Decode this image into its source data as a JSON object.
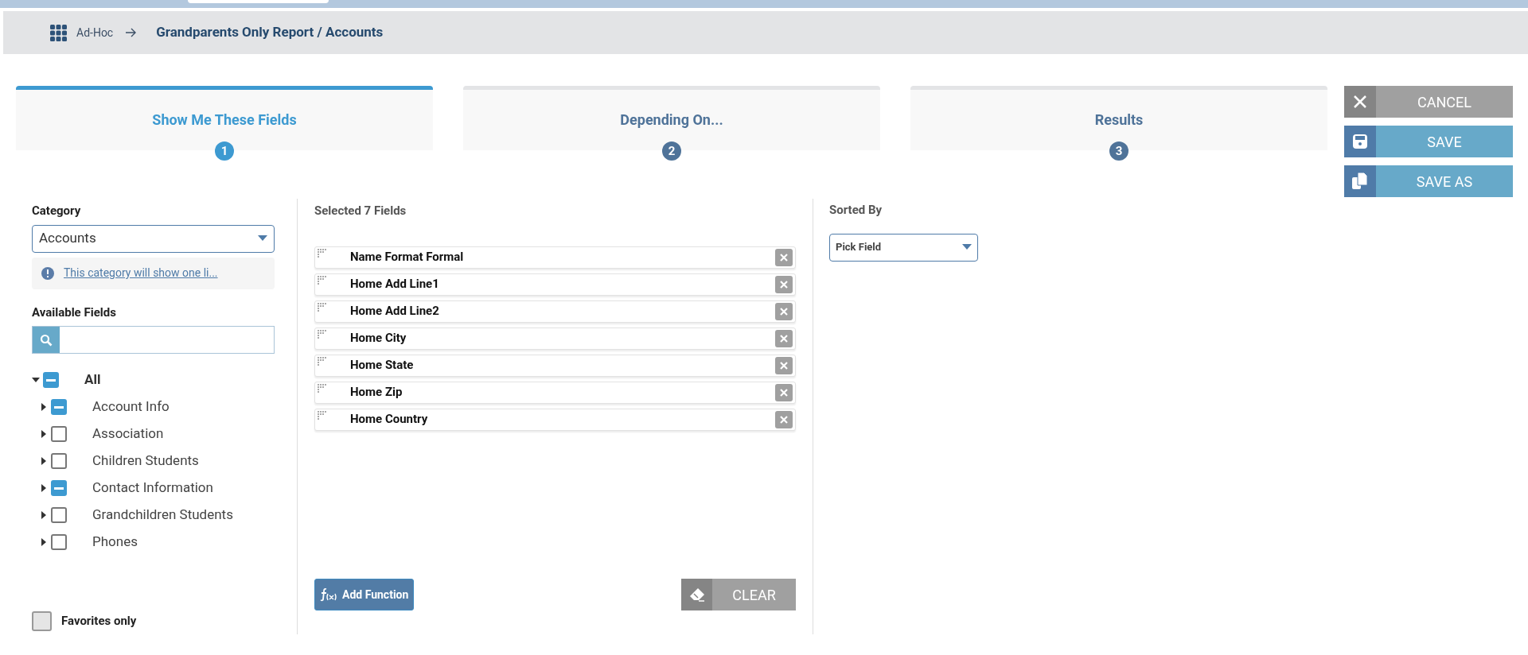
{
  "breadcrumb": {
    "root": "Ad-Hoc",
    "title": "Grandparents Only Report / Accounts"
  },
  "steps": [
    {
      "label": "Show Me These Fields",
      "number": "1",
      "selected": true
    },
    {
      "label": "Depending On...",
      "number": "2",
      "selected": false
    },
    {
      "label": "Results",
      "number": "3",
      "selected": false
    }
  ],
  "actions": [
    {
      "kind": "cancel",
      "label": "CANCEL"
    },
    {
      "kind": "save",
      "label": "SAVE"
    },
    {
      "kind": "save_as",
      "label": "SAVE AS"
    }
  ],
  "category": {
    "label": "Category",
    "value": "Accounts",
    "info": "This category will show one li..."
  },
  "available_fields": {
    "label": "Available Fields",
    "tree": [
      {
        "label": "All",
        "partial": true,
        "expanded": true,
        "children": [
          {
            "label": "Account Info",
            "partial": true,
            "expanded": false
          },
          {
            "label": "Association",
            "partial": false,
            "expanded": false
          },
          {
            "label": "Children Students",
            "partial": false,
            "expanded": false
          },
          {
            "label": "Contact Information",
            "partial": true,
            "expanded": false
          },
          {
            "label": "Grandchildren Students",
            "partial": false,
            "expanded": false
          },
          {
            "label": "Phones",
            "partial": false,
            "expanded": false
          }
        ]
      }
    ]
  },
  "favorites": {
    "label": "Favorites only",
    "checked": false
  },
  "selected": {
    "title": "Selected 7 Fields",
    "fields": [
      "Name Format Formal",
      "Home Add Line1",
      "Home Add Line2",
      "Home City",
      "Home State",
      "Home Zip",
      "Home Country"
    ],
    "add_function": "Add Function",
    "clear": "CLEAR"
  },
  "sorted_by": {
    "label": "Sorted By",
    "value": "Pick Field"
  }
}
